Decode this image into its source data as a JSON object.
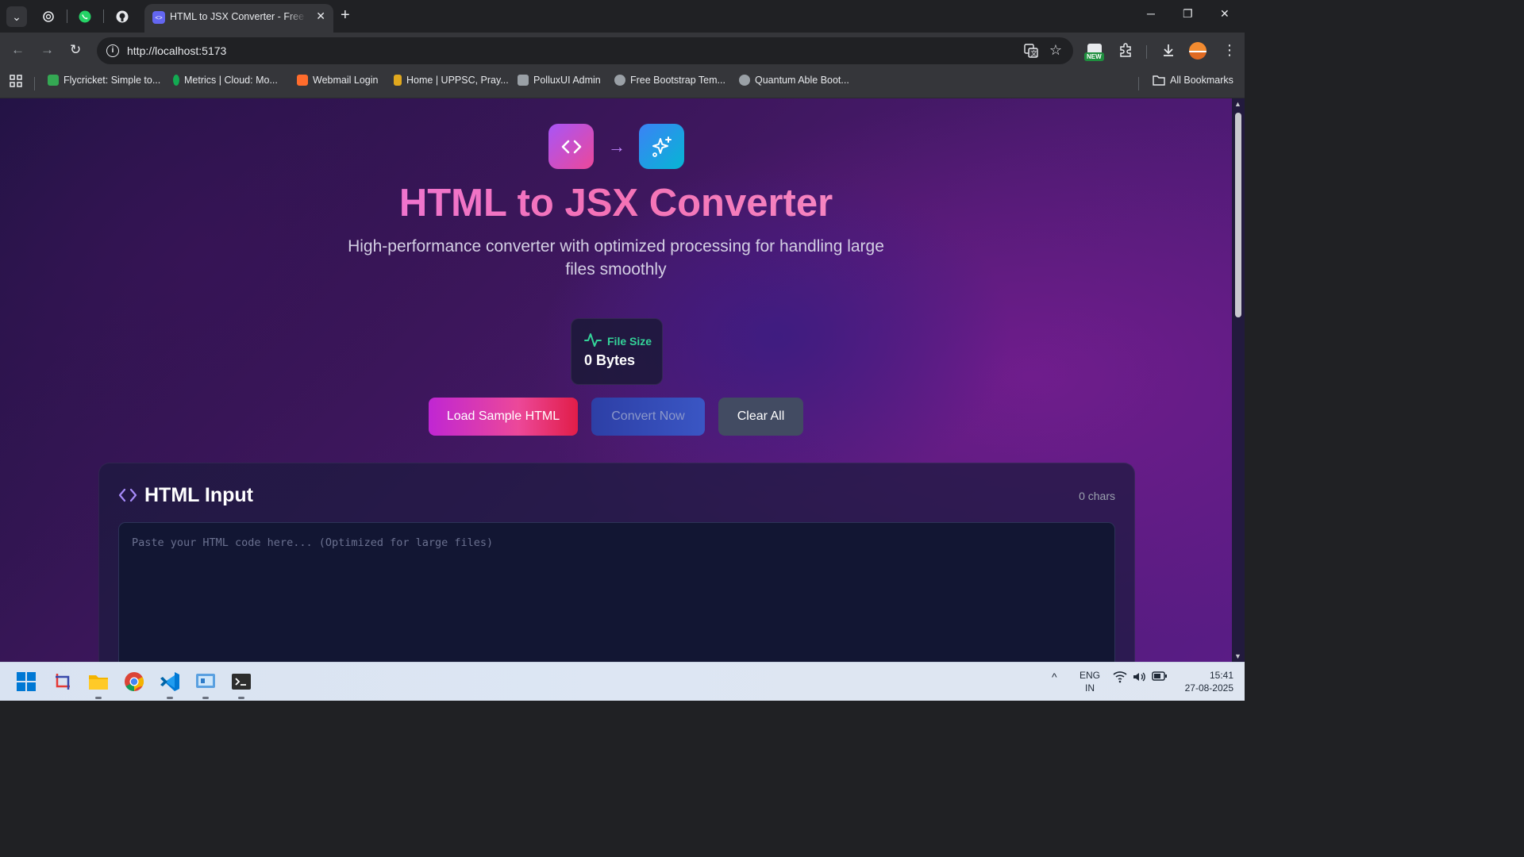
{
  "browser": {
    "active_tab_title": "HTML to JSX Converter - Free C",
    "url": "http://localhost:5173",
    "pinned_tabs": [
      "chatgpt-icon",
      "whatsapp-icon",
      "github-icon"
    ],
    "bookmarks": [
      {
        "label": "Flycricket: Simple to...",
        "color": "#34a853"
      },
      {
        "label": "Metrics | Cloud: Mo...",
        "color": "#13aa52"
      },
      {
        "label": "Webmail Login",
        "color": "#ff6c2c"
      },
      {
        "label": "Home | UPPSC, Pray...",
        "color": "#e0a81e"
      },
      {
        "label": "PolluxUI Admin",
        "color": "#9aa0a6"
      },
      {
        "label": "Free Bootstrap Tem...",
        "color": "#9aa0a6"
      },
      {
        "label": "Quantum Able Boot...",
        "color": "#9aa0a6"
      }
    ],
    "all_bookmarks_label": "All Bookmarks",
    "new_badge": "NEW"
  },
  "app": {
    "title": "HTML to JSX Converter",
    "subtitle": "High-performance converter with optimized processing for handling large files smoothly",
    "stat": {
      "label": "File Size",
      "value": "0 Bytes"
    },
    "buttons": {
      "load": "Load Sample HTML",
      "convert": "Convert Now",
      "clear": "Clear All"
    },
    "input_panel": {
      "title": "HTML Input",
      "count": "0 chars",
      "placeholder": "Paste your HTML code here... (Optimized for large files)"
    }
  },
  "taskbar": {
    "language_top": "ENG",
    "language_bottom": "IN",
    "time": "15:41",
    "date": "27-08-2025"
  },
  "colors": {
    "title_gradient": [
      "#e879f9",
      "#f472b6"
    ],
    "accent_green": "#34d399",
    "load_button": "#ec4899"
  }
}
